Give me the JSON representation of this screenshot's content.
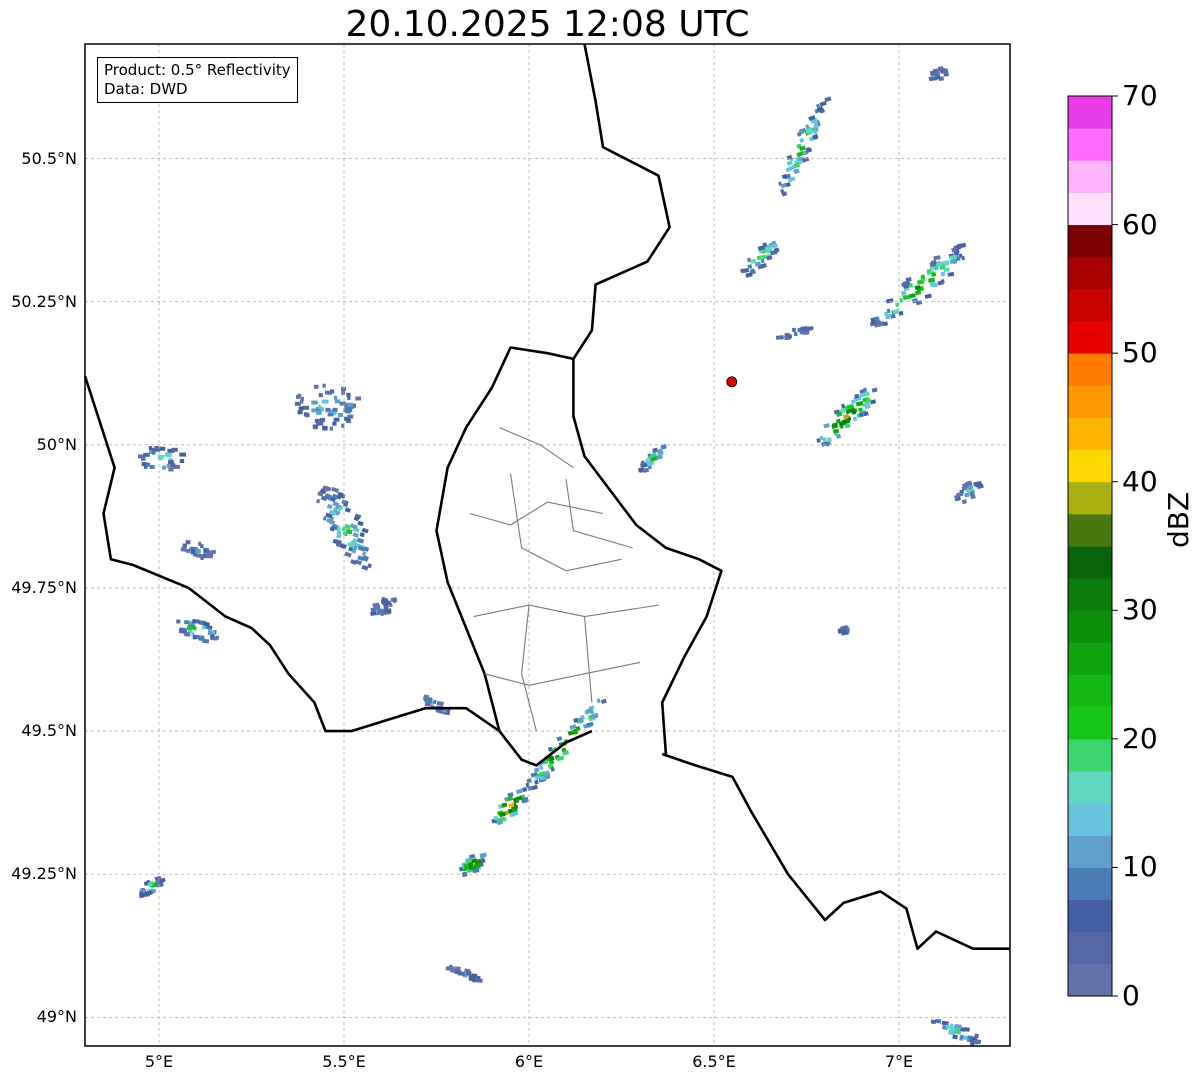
{
  "title": "20.10.2025 12:08 UTC",
  "info": {
    "product": "Product: 0.5° Reflectivity",
    "data": "Data: DWD"
  },
  "map": {
    "lon_range": [
      4.8,
      7.3
    ],
    "lat_range": [
      48.95,
      50.7
    ],
    "lon_ticks": [
      {
        "value": 5.0,
        "label": "5°E"
      },
      {
        "value": 5.5,
        "label": "5.5°E"
      },
      {
        "value": 6.0,
        "label": "6°E"
      },
      {
        "value": 6.5,
        "label": "6.5°E"
      },
      {
        "value": 7.0,
        "label": "7°E"
      }
    ],
    "lat_ticks": [
      {
        "value": 49.0,
        "label": "49°N"
      },
      {
        "value": 49.25,
        "label": "49.25°N"
      },
      {
        "value": 49.5,
        "label": "49.5°N"
      },
      {
        "value": 49.75,
        "label": "49.75°N"
      },
      {
        "value": 50.0,
        "label": "50°N"
      },
      {
        "value": 50.25,
        "label": "50.25°N"
      },
      {
        "value": 50.5,
        "label": "50.5°N"
      }
    ],
    "grid": true,
    "radar_site": {
      "lon": 6.548,
      "lat": 50.11,
      "color": "#e00000"
    }
  },
  "colorbar": {
    "label": "dBZ",
    "range": [
      0,
      70
    ],
    "step": 2.5,
    "ticks": [
      0,
      10,
      20,
      30,
      40,
      50,
      60,
      70
    ],
    "colors": [
      "#6373a8",
      "#5468a6",
      "#4460a4",
      "#4c7cb4",
      "#5f9fca",
      "#68c4dc",
      "#5fd8c0",
      "#3cd56c",
      "#14c818",
      "#14b814",
      "#10a410",
      "#0c900c",
      "#0c7c0c",
      "#0a620a",
      "#487810",
      "#aab010",
      "#ffd700",
      "#ffb400",
      "#ff9800",
      "#ff7c00",
      "#e80000",
      "#c80000",
      "#a80000",
      "#7c0000",
      "#ffe0ff",
      "#ffb4ff",
      "#ff6cff",
      "#e83ce8"
    ]
  },
  "echoes": [
    {
      "lon": 6.73,
      "lat": 50.52,
      "len": 0.3,
      "wid": 0.05,
      "ang": 64,
      "core": 24,
      "dens": 1.0
    },
    {
      "lon": 6.62,
      "lat": 50.33,
      "len": 0.14,
      "wid": 0.04,
      "ang": 45,
      "core": 24,
      "dens": 0.9
    },
    {
      "lon": 6.85,
      "lat": 50.05,
      "len": 0.22,
      "wid": 0.06,
      "ang": 45,
      "core": 42,
      "dens": 1.0
    },
    {
      "lon": 7.05,
      "lat": 50.28,
      "len": 0.34,
      "wid": 0.07,
      "ang": 40,
      "core": 30,
      "dens": 1.0
    },
    {
      "lon": 7.1,
      "lat": 50.65,
      "len": 0.05,
      "wid": 0.03,
      "ang": 30,
      "core": 10,
      "dens": 0.8
    },
    {
      "lon": 7.18,
      "lat": 49.92,
      "len": 0.08,
      "wid": 0.04,
      "ang": 45,
      "core": 18,
      "dens": 0.7
    },
    {
      "lon": 6.09,
      "lat": 49.48,
      "len": 0.35,
      "wid": 0.045,
      "ang": 50,
      "core": 40,
      "dens": 1.0
    },
    {
      "lon": 5.94,
      "lat": 49.37,
      "len": 0.12,
      "wid": 0.05,
      "ang": 48,
      "core": 52,
      "dens": 1.0
    },
    {
      "lon": 5.84,
      "lat": 49.27,
      "len": 0.08,
      "wid": 0.04,
      "ang": 40,
      "core": 42,
      "dens": 1.0
    },
    {
      "lon": 5.1,
      "lat": 49.68,
      "len": 0.12,
      "wid": 0.05,
      "ang": -20,
      "core": 28,
      "dens": 1.0
    },
    {
      "lon": 4.97,
      "lat": 49.23,
      "len": 0.07,
      "wid": 0.03,
      "ang": 40,
      "core": 30,
      "dens": 1.0
    },
    {
      "lon": 5.5,
      "lat": 49.86,
      "len": 0.25,
      "wid": 0.09,
      "ang": -60,
      "core": 22,
      "dens": 0.8
    },
    {
      "lon": 5.45,
      "lat": 50.07,
      "len": 0.18,
      "wid": 0.12,
      "ang": 0,
      "core": 15,
      "dens": 0.6
    },
    {
      "lon": 5.0,
      "lat": 49.98,
      "len": 0.12,
      "wid": 0.07,
      "ang": 0,
      "core": 20,
      "dens": 0.7
    },
    {
      "lon": 5.1,
      "lat": 49.82,
      "len": 0.1,
      "wid": 0.04,
      "ang": -20,
      "core": 10,
      "dens": 0.6
    },
    {
      "lon": 5.74,
      "lat": 49.55,
      "len": 0.1,
      "wid": 0.02,
      "ang": -30,
      "core": 14,
      "dens": 0.9
    },
    {
      "lon": 6.33,
      "lat": 49.98,
      "len": 0.1,
      "wid": 0.03,
      "ang": 45,
      "core": 24,
      "dens": 0.8
    },
    {
      "lon": 5.82,
      "lat": 49.08,
      "len": 0.1,
      "wid": 0.02,
      "ang": -20,
      "core": 10,
      "dens": 0.9
    },
    {
      "lon": 7.15,
      "lat": 48.98,
      "len": 0.14,
      "wid": 0.04,
      "ang": -25,
      "core": 18,
      "dens": 1.0
    },
    {
      "lon": 5.6,
      "lat": 49.72,
      "len": 0.08,
      "wid": 0.04,
      "ang": 30,
      "core": 10,
      "dens": 0.7
    },
    {
      "lon": 6.85,
      "lat": 49.68,
      "len": 0.04,
      "wid": 0.015,
      "ang": 30,
      "core": 8,
      "dens": 0.7
    },
    {
      "lon": 6.72,
      "lat": 50.2,
      "len": 0.12,
      "wid": 0.02,
      "ang": 20,
      "core": 8,
      "dens": 0.6
    }
  ]
}
